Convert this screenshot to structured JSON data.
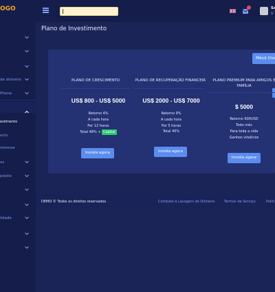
{
  "sidebar": {
    "logo": "OGO",
    "items": [
      {
        "label": ""
      },
      {
        "label": ""
      },
      {
        "label": ""
      },
      {
        "label": "de dinheiro"
      },
      {
        "label": "Phone"
      },
      {
        "label": ""
      },
      {
        "label": ""
      },
      {
        "label": "os"
      },
      {
        "label": "pósito"
      },
      {
        "label": ""
      },
      {
        "label": ""
      },
      {
        "label": "lidade"
      },
      {
        "label": ""
      },
      {
        "label": ""
      }
    ],
    "subitems": [
      {
        "label": "estimento",
        "active": true
      },
      {
        "label": "ento",
        "active": false
      },
      {
        "label": "nteresse",
        "active": false
      }
    ]
  },
  "topbar": {
    "search_placeholder": "",
    "user_name": "Sa",
    "user_sub": "U"
  },
  "page": {
    "title": "Plano de Investimento",
    "meus_button": "Meus Inve"
  },
  "plans": [
    {
      "title": "PLANO DE CRESCIMENTO",
      "price": "US$ 800 - US$ 5000",
      "lines": [
        "Retorno 4%",
        "A cada hora",
        "Por 12 horas"
      ],
      "total_text": "Total 48% +",
      "badge": "Capital",
      "button": "Invista agora"
    },
    {
      "title": "PLANO DE RECUPERAÇÃO FINANCEIR",
      "price": "US$ 2000 - US$ 7000",
      "lines": [
        "Retorno 9%",
        "A cada hora",
        "Por 5 horas",
        "Total 45%"
      ],
      "button": "Invista agora"
    },
    {
      "title": "PLANO PREMIUM PARA AMIGOS E FAMÍLIA",
      "price": "$ 5000",
      "lines": [
        "Retorno 600USD",
        "Todo mês",
        "Para toda a vida",
        "Ganhos vitalícios"
      ],
      "button": "Invista agora"
    }
  ],
  "footer": {
    "copyright": "DEMO © Todos os direitos reservados",
    "links": [
      "Combate à Lavagem de Dinheiro",
      "Termos de Serviço",
      "Politi"
    ]
  },
  "colors": {
    "background": "#1b2456",
    "sidebar": "#151d4a",
    "panel": "#243173",
    "accent": "#5b8def",
    "logo": "#f5a623",
    "badge_green": "#28c76f"
  }
}
